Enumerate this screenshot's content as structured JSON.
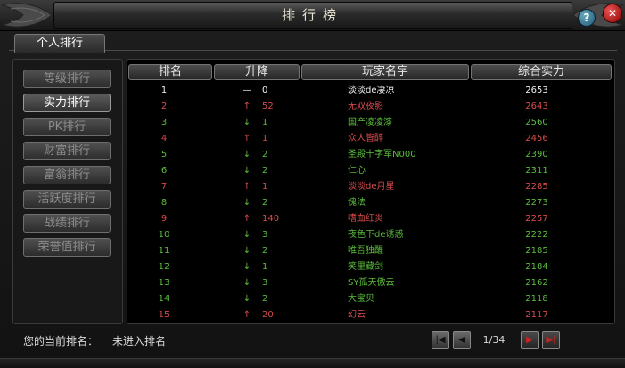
{
  "window": {
    "title": "排行榜",
    "help_label": "?",
    "close_label": "✕"
  },
  "tabs": [
    {
      "label": "个人排行",
      "active": true
    }
  ],
  "categories": [
    {
      "label": "等级排行",
      "active": false
    },
    {
      "label": "实力排行",
      "active": true
    },
    {
      "label": "PK排行",
      "active": false
    },
    {
      "label": "财富排行",
      "active": false
    },
    {
      "label": "富翁排行",
      "active": false
    },
    {
      "label": "活跃度排行",
      "active": false
    },
    {
      "label": "战绩排行",
      "active": false
    },
    {
      "label": "荣誉值排行",
      "active": false
    }
  ],
  "table": {
    "headers": {
      "rank": "排名",
      "change": "升降",
      "name": "玩家名字",
      "power": "综合实力"
    },
    "rows": [
      {
        "rank": "1",
        "dir": "same",
        "arrow": "—",
        "delta": "0",
        "name": "淡淡de凄凉",
        "power": "2653"
      },
      {
        "rank": "2",
        "dir": "up",
        "arrow": "↑",
        "delta": "52",
        "name": "无双夜影",
        "power": "2643"
      },
      {
        "rank": "3",
        "dir": "down",
        "arrow": "↓",
        "delta": "1",
        "name": "国产凌凌漆",
        "power": "2560"
      },
      {
        "rank": "4",
        "dir": "up",
        "arrow": "↑",
        "delta": "1",
        "name": "众人皆醉",
        "power": "2456"
      },
      {
        "rank": "5",
        "dir": "down",
        "arrow": "↓",
        "delta": "2",
        "name": "圣殿十字军N000",
        "power": "2390"
      },
      {
        "rank": "6",
        "dir": "down",
        "arrow": "↓",
        "delta": "2",
        "name": "仁心",
        "power": "2311"
      },
      {
        "rank": "7",
        "dir": "up",
        "arrow": "↑",
        "delta": "1",
        "name": "淡淡de月星",
        "power": "2285"
      },
      {
        "rank": "8",
        "dir": "down",
        "arrow": "↓",
        "delta": "2",
        "name": "傀法",
        "power": "2273"
      },
      {
        "rank": "9",
        "dir": "up",
        "arrow": "↑",
        "delta": "140",
        "name": "嗜血红炎",
        "power": "2257"
      },
      {
        "rank": "10",
        "dir": "down",
        "arrow": "↓",
        "delta": "3",
        "name": "夜色下de诱惑",
        "power": "2222"
      },
      {
        "rank": "11",
        "dir": "down",
        "arrow": "↓",
        "delta": "2",
        "name": "唯吾独醒",
        "power": "2185"
      },
      {
        "rank": "12",
        "dir": "down",
        "arrow": "↓",
        "delta": "1",
        "name": "笑里藏剑",
        "power": "2184"
      },
      {
        "rank": "13",
        "dir": "down",
        "arrow": "↓",
        "delta": "3",
        "name": "SY孤天傲云",
        "power": "2162"
      },
      {
        "rank": "14",
        "dir": "down",
        "arrow": "↓",
        "delta": "2",
        "name": "大宝贝",
        "power": "2118"
      },
      {
        "rank": "15",
        "dir": "up",
        "arrow": "↑",
        "delta": "20",
        "name": "幻云",
        "power": "2117"
      }
    ]
  },
  "footer": {
    "current_rank_label": "您的当前排名：",
    "current_rank_value": "未进入排名",
    "page": "1/34",
    "first_icon": "first-page-icon",
    "prev_icon": "prev-page-icon",
    "next_icon": "next-page-icon",
    "last_icon": "last-page-icon"
  },
  "colors": {
    "up": "#d84c4c",
    "down": "#5bbd3c",
    "same": "#f0f0f0",
    "accent_red": "#d02020"
  }
}
